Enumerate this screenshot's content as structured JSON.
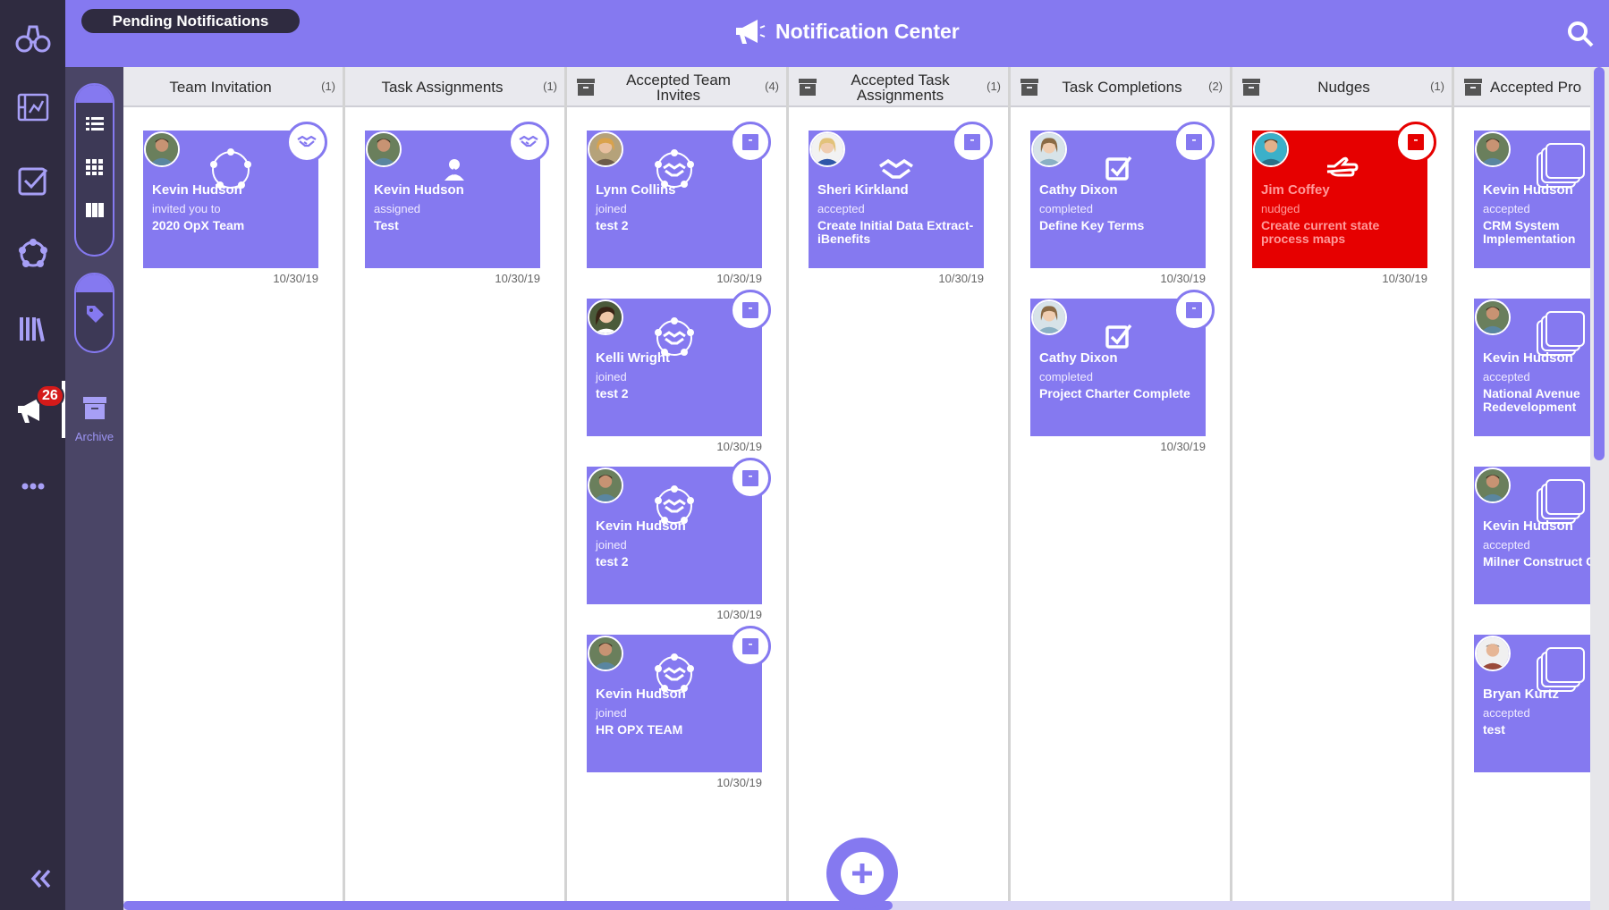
{
  "header": {
    "pending_label": "Pending Notifications",
    "title": "Notification Center"
  },
  "nav": {
    "badge": "26"
  },
  "subnav": {
    "archive_label": "Archive"
  },
  "columns": [
    {
      "title": "Team Invitation",
      "count": "(1)",
      "cards": [
        {
          "name": "Kevin Hudson",
          "action": "invited you to",
          "subject": "2020 OpX Team",
          "date": "10/30/19"
        }
      ]
    },
    {
      "title": "Task Assignments",
      "count": "(1)",
      "cards": [
        {
          "name": "Kevin Hudson",
          "action": "assigned",
          "subject": "Test",
          "date": "10/30/19"
        }
      ]
    },
    {
      "title": "Accepted Team Invites",
      "count": "(4)",
      "cards": [
        {
          "name": "Lynn Collins",
          "action": "joined",
          "subject": "test 2",
          "date": "10/30/19"
        },
        {
          "name": "Kelli Wright",
          "action": "joined",
          "subject": "test 2",
          "date": "10/30/19"
        },
        {
          "name": "Kevin Hudson",
          "action": "joined",
          "subject": "test 2",
          "date": "10/30/19"
        },
        {
          "name": "Kevin Hudson",
          "action": "joined",
          "subject": "HR OPX TEAM",
          "date": "10/30/19"
        }
      ]
    },
    {
      "title": "Accepted Task Assignments",
      "count": "(1)",
      "cards": [
        {
          "name": "Sheri Kirkland",
          "action": "accepted",
          "subject": "Create Initial Data Extract-iBenefits",
          "date": "10/30/19"
        }
      ]
    },
    {
      "title": "Task Completions",
      "count": "(2)",
      "cards": [
        {
          "name": "Cathy Dixon",
          "action": "completed",
          "subject": "Define Key Terms",
          "date": "10/30/19"
        },
        {
          "name": "Cathy Dixon",
          "action": "completed",
          "subject": "Project Charter Complete",
          "date": "10/30/19"
        }
      ]
    },
    {
      "title": "Nudges",
      "count": "(1)",
      "cards": [
        {
          "name": "Jim Coffey",
          "action": "nudged",
          "subject": "Create current state process maps",
          "date": "10/30/19"
        }
      ]
    },
    {
      "title": "Accepted Pro",
      "count": "",
      "cards": [
        {
          "name": "Kevin Hudson",
          "action": "accepted",
          "subject": "CRM System Implementation",
          "date": ""
        },
        {
          "name": "Kevin Hudson",
          "action": "accepted",
          "subject": "National Avenue Redevelopment",
          "date": ""
        },
        {
          "name": "Kevin Hudson",
          "action": "accepted",
          "subject": "Milner Construct COPY",
          "date": ""
        },
        {
          "name": "Bryan Kurtz",
          "action": "accepted",
          "subject": "test",
          "date": ""
        }
      ]
    }
  ],
  "colors": {
    "primary": "#8579f0",
    "nav_bg": "#2f2b40",
    "nudge_red": "#e60000"
  }
}
